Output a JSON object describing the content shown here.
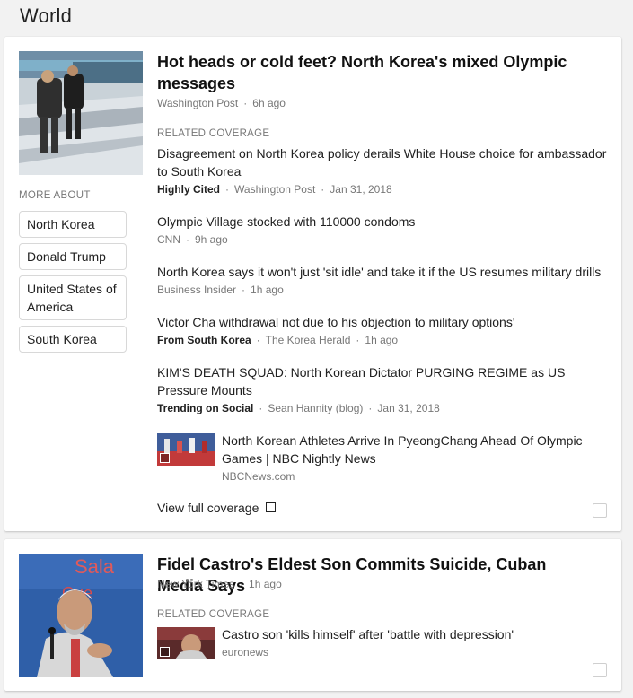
{
  "section": {
    "title": "World"
  },
  "cards": [
    {
      "headline": "Hot heads or cold feet? North Korea's mixed Olympic messages",
      "source": "Washington Post",
      "time": "6h ago",
      "more_about_label": "MORE ABOUT",
      "topics": [
        "North Korea",
        "Donald Trump",
        "United States of America",
        "South Korea"
      ],
      "related_label": "RELATED COVERAGE",
      "related": [
        {
          "title": "Disagreement on North Korea policy derails White House choice for ambassador to South Korea",
          "tag": "Highly Cited",
          "source": "Washington Post",
          "time": "Jan 31, 2018"
        },
        {
          "title": "Olympic Village stocked with 110000 condoms",
          "tag": "",
          "source": "CNN",
          "time": "9h ago"
        },
        {
          "title": "North Korea says it won't just 'sit idle' and take it if the US resumes military drills",
          "tag": "",
          "source": "Business Insider",
          "time": "1h ago"
        },
        {
          "title": "Victor Cha withdrawal not due to his objection to military options'",
          "tag": "From South Korea",
          "source": "The Korea Herald",
          "time": "1h ago"
        },
        {
          "title": "KIM'S DEATH SQUAD: North Korean Dictator PURGING REGIME as US Pressure Mounts",
          "tag": "Trending on Social",
          "source": "Sean Hannity (blog)",
          "time": "Jan 31, 2018"
        }
      ],
      "video": {
        "title": "North Korean Athletes Arrive In PyeongChang Ahead Of Olympic Games | NBC Nightly News",
        "source": "NBCNews.com"
      },
      "view_full": "View full coverage"
    },
    {
      "headline": "Fidel Castro's Eldest Son Commits Suicide, Cuban Media Says",
      "source": "New York Times",
      "time": "1h ago",
      "related_label": "RELATED COVERAGE",
      "video": {
        "title": "Castro son 'kills himself' after 'battle with depression'",
        "source": "euronews"
      }
    }
  ]
}
